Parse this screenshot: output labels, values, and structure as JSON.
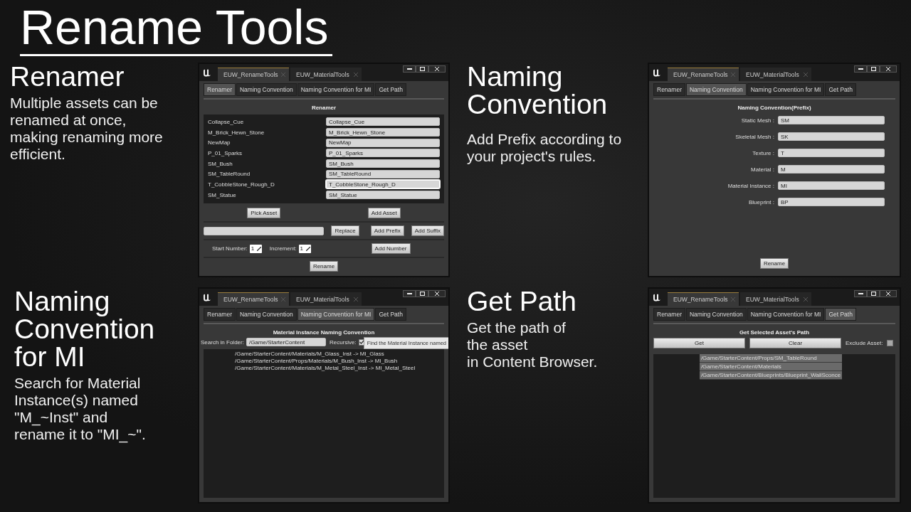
{
  "title": "Rename Tools",
  "sections": [
    {
      "heading": "Renamer",
      "description": "Multiple assets can be\nrenamed at once,\nmaking renaming more\nefficient.",
      "window": {
        "kind": "renamer",
        "doc_tabs": [
          {
            "label": "EUW_RenameTools",
            "selected": true
          },
          {
            "label": "EUW_MaterialTools",
            "selected": false
          }
        ],
        "tabs": [
          {
            "label": "Renamer",
            "selected": true
          },
          {
            "label": "Naming Convention",
            "selected": false
          },
          {
            "label": "Naming Convention for MI",
            "selected": false
          },
          {
            "label": "Get Path",
            "selected": false
          }
        ],
        "panel": {
          "heading": "Renamer",
          "assets": [
            {
              "name": "Collapse_Cue",
              "new_name": "Collapse_Cue",
              "focused": false
            },
            {
              "name": "M_Brick_Hewn_Stone",
              "new_name": "M_Brick_Hewn_Stone",
              "focused": false
            },
            {
              "name": "NewMap",
              "new_name": "NewMap",
              "focused": false
            },
            {
              "name": "P_01_Sparks",
              "new_name": "P_01_Sparks",
              "focused": false
            },
            {
              "name": "SM_Bush",
              "new_name": "SM_Bush",
              "focused": false
            },
            {
              "name": "SM_TableRound",
              "new_name": "SM_TableRound",
              "focused": false
            },
            {
              "name": "T_CobbleStone_Rough_D",
              "new_name": "T_CobbleStone_Rough_D",
              "focused": true
            },
            {
              "name": "SM_Statue",
              "new_name": "SM_Statue",
              "focused": false
            }
          ],
          "pick_button": "Pick Asset",
          "add_button": "Add Asset",
          "replace_button": "Replace",
          "prefix_button": "Add Prefix",
          "suffix_button": "Add Suffix",
          "start_label": "Start Number:",
          "start_value": "1",
          "increment_label": "Increment:",
          "increment_value": "1",
          "number_button": "Add Number",
          "rename_button": "Rename"
        }
      }
    },
    {
      "heading": "Naming\nConvention",
      "description": "Add Prefix according to\nyour project's rules.",
      "window": {
        "kind": "naming",
        "doc_tabs": [
          {
            "label": "EUW_RenameTools",
            "selected": true
          },
          {
            "label": "EUW_MaterialTools",
            "selected": false
          }
        ],
        "tabs": [
          {
            "label": "Renamer",
            "selected": false
          },
          {
            "label": "Naming Convention",
            "selected": true
          },
          {
            "label": "Naming Convention for MI",
            "selected": false
          },
          {
            "label": "Get Path",
            "selected": false
          }
        ],
        "panel": {
          "heading": "Naming Convention(Prefix)",
          "fields": [
            {
              "label": "Static Mesh :",
              "value": "SM"
            },
            {
              "label": "Skeletal Mesh :",
              "value": "SK"
            },
            {
              "label": "Texture :",
              "value": "T"
            },
            {
              "label": "Material :",
              "value": "M"
            },
            {
              "label": "Material Instance :",
              "value": "MI"
            },
            {
              "label": "Blueprint :",
              "value": "BP"
            }
          ],
          "rename_button": "Rename"
        }
      }
    },
    {
      "heading": "Naming\nConvention\nfor MI",
      "description": "Search for Material\nInstance(s) named\n\"M_~Inst\" and\nrename it to \"MI_~\".",
      "window": {
        "kind": "mi",
        "doc_tabs": [
          {
            "label": "EUW_RenameTools",
            "selected": true
          },
          {
            "label": "EUW_MaterialTools",
            "selected": false
          }
        ],
        "tabs": [
          {
            "label": "Renamer",
            "selected": false
          },
          {
            "label": "Naming Convention",
            "selected": false
          },
          {
            "label": "Naming Convention for MI",
            "selected": true
          },
          {
            "label": "Get Path",
            "selected": false
          }
        ],
        "panel": {
          "heading": "Material Instance Naming Convention",
          "folder_label": "Search in Folder:",
          "folder_value": "/Game/StarterContent",
          "recursive_label": "Recursive:",
          "recursive_checked": true,
          "tooltip": "Find the Material Instance named",
          "results": [
            "/Game/StarterContent/Materials/M_Glass_Inst -> MI_Glass",
            "/Game/StarterContent/Props/Materials/M_Bush_Inst -> MI_Bush",
            "/Game/StarterContent/Materials/M_Metal_Steel_Inst -> MI_Metal_Steel"
          ]
        }
      }
    },
    {
      "heading": "Get Path",
      "description": "Get the path of\nthe asset\nin Content Browser.",
      "window": {
        "kind": "get_path",
        "doc_tabs": [
          {
            "label": "EUW_RenameTools",
            "selected": true
          },
          {
            "label": "EUW_MaterialTools",
            "selected": false
          }
        ],
        "tabs": [
          {
            "label": "Renamer",
            "selected": false
          },
          {
            "label": "Naming Convention",
            "selected": false
          },
          {
            "label": "Naming Convention for MI",
            "selected": false
          },
          {
            "label": "Get Path",
            "selected": true
          }
        ],
        "panel": {
          "heading": "Get Selected Asset's Path",
          "get_button": "Get",
          "clear_button": "Clear",
          "exclude_label": "Exclude Asset:",
          "exclude_checked": false,
          "paths": [
            "/Game/StarterContent/Props/SM_TableRound",
            "/Game/StarterContent/Materials",
            "/Game/StarterContent/Blueprints/Blueprint_WallSconce"
          ]
        }
      }
    }
  ]
}
